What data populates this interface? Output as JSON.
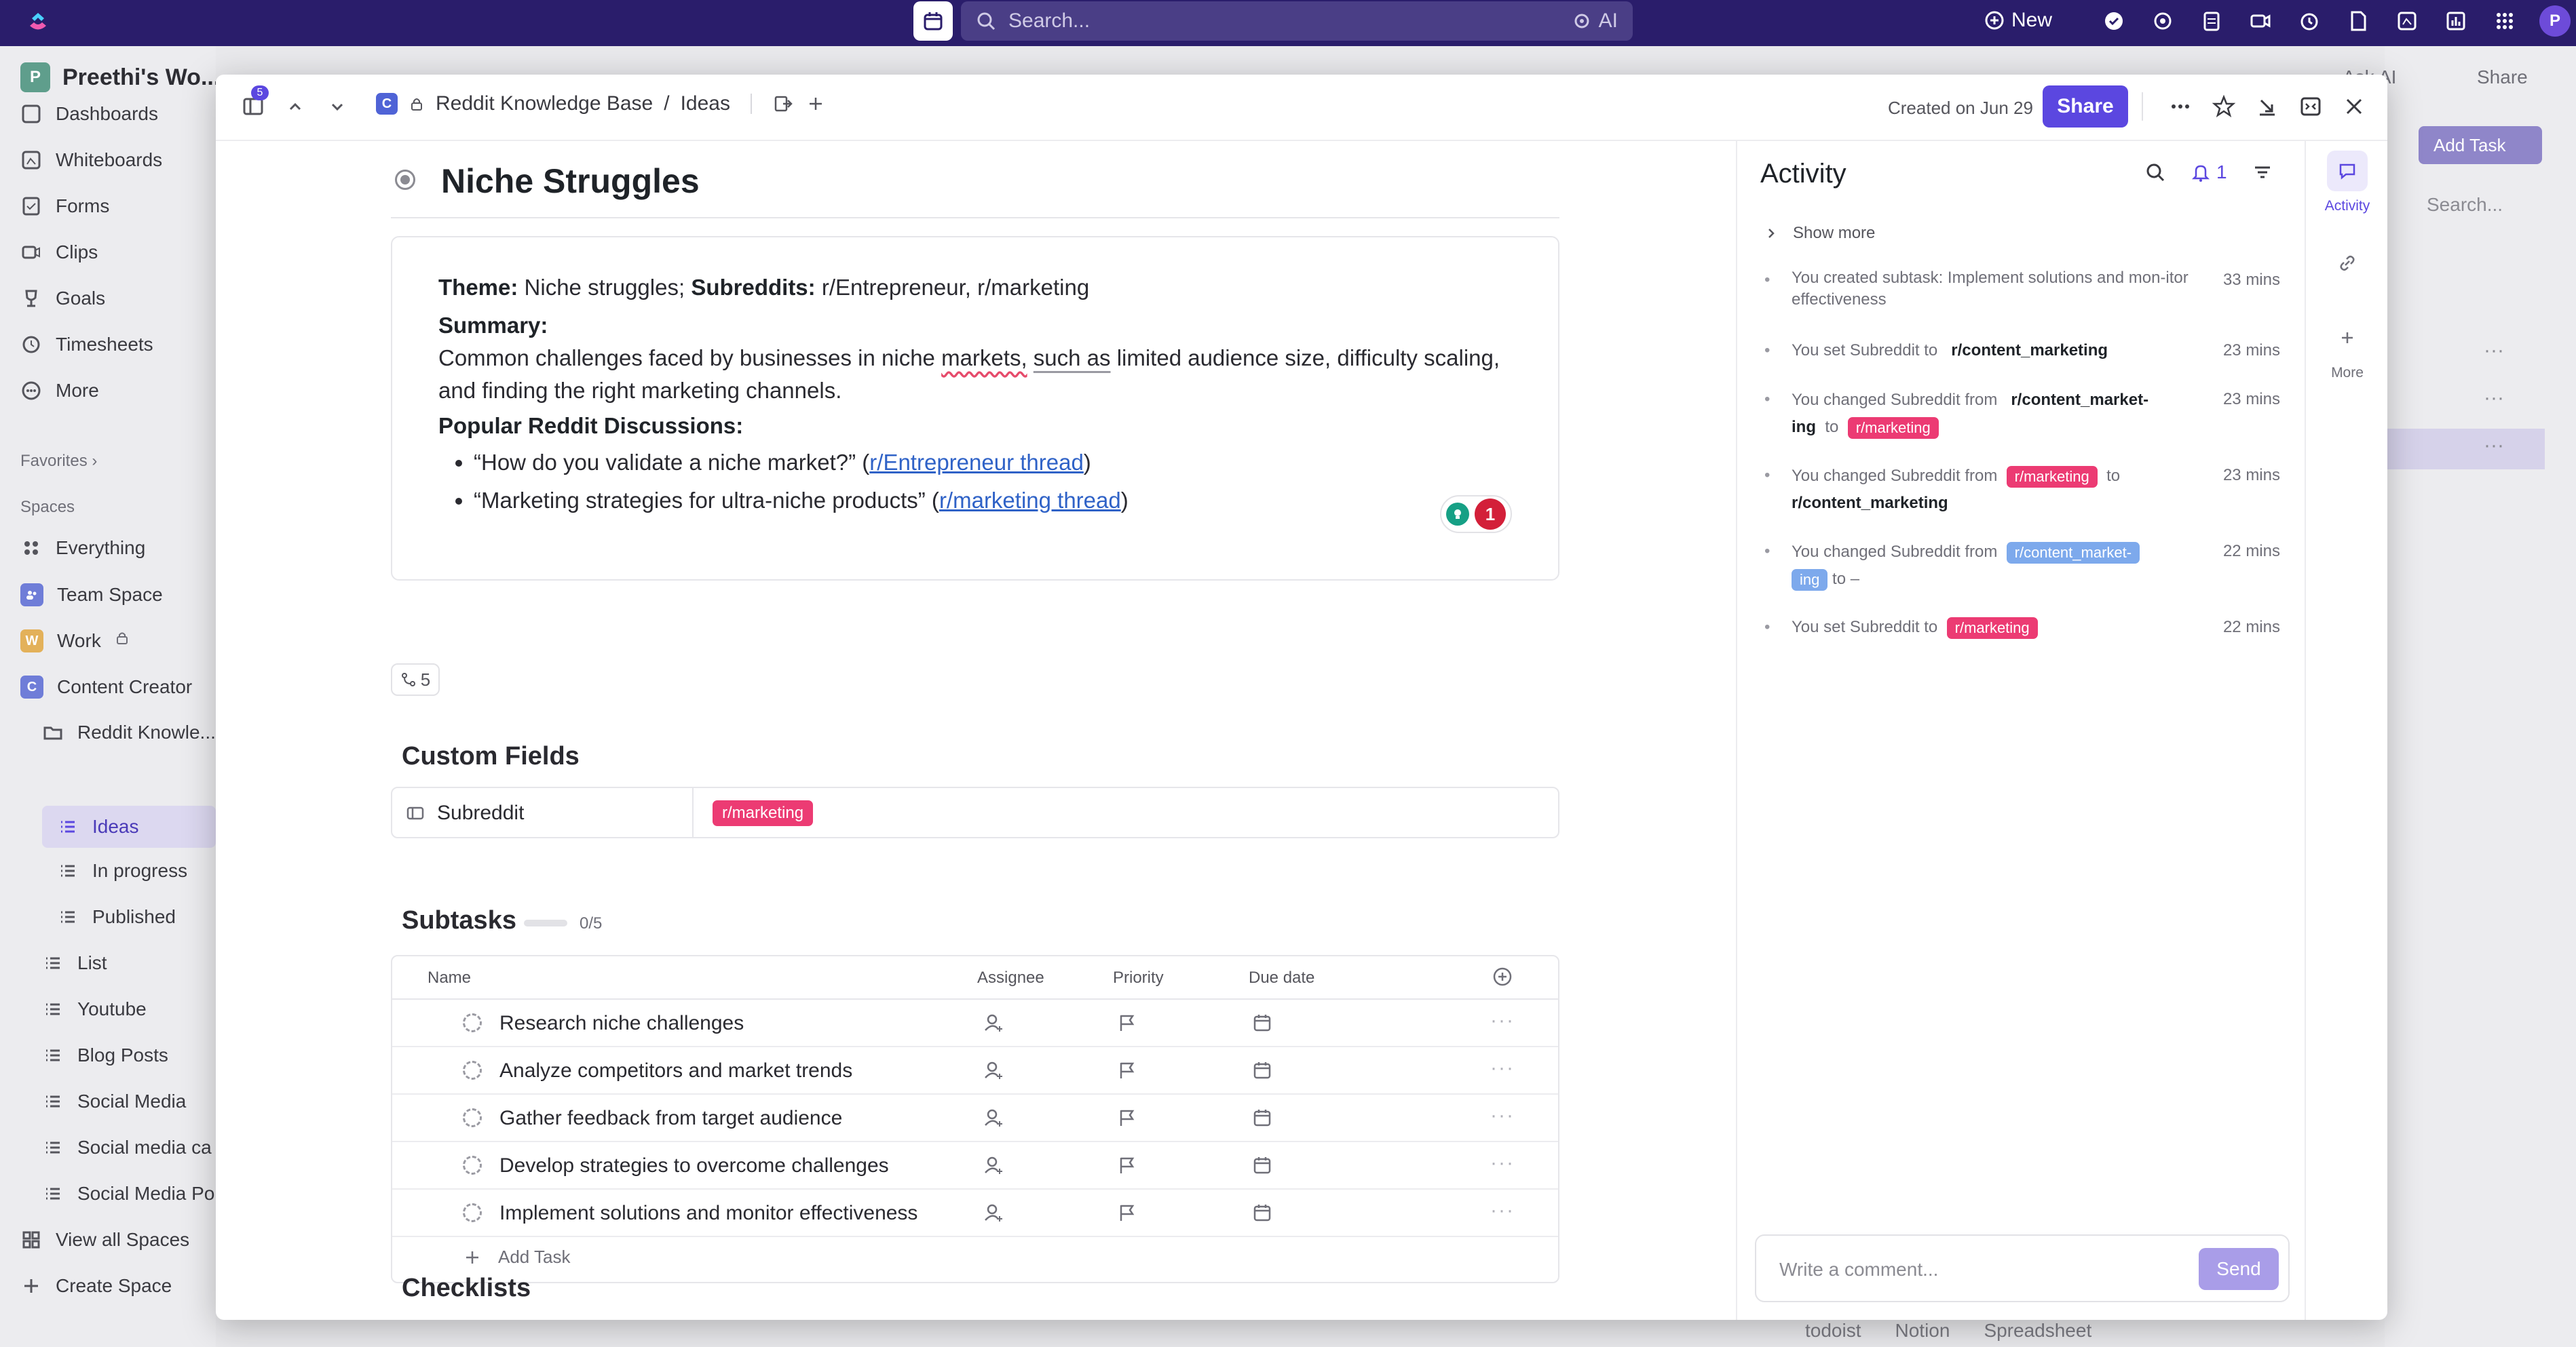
{
  "topbar": {
    "search_placeholder": "Search...",
    "ai_label": "AI",
    "new_label": "New",
    "avatar_initial": "P",
    "icons": [
      "check-circle-icon",
      "gear-icon",
      "clipboard-icon",
      "video-icon",
      "alarm-clock-icon",
      "document-icon",
      "whiteboard-icon",
      "dashboard-icon",
      "apps-grid-icon"
    ]
  },
  "sidebar": {
    "workspace_initial": "P",
    "workspace_name": "Preethi's Wo...",
    "items": [
      {
        "label": "Dashboards",
        "icon": "dashboard-icon"
      },
      {
        "label": "Whiteboards",
        "icon": "whiteboard-icon"
      },
      {
        "label": "Forms",
        "icon": "forms-icon"
      },
      {
        "label": "Clips",
        "icon": "clips-icon"
      },
      {
        "label": "Goals",
        "icon": "trophy-icon"
      },
      {
        "label": "Timesheets",
        "icon": "timesheet-icon"
      },
      {
        "label": "More",
        "icon": "more-icon"
      }
    ],
    "favorites_label": "Favorites",
    "spaces_label": "Spaces",
    "spaces": [
      {
        "label": "Everything"
      },
      {
        "label": "Team Space"
      },
      {
        "label": "Work",
        "initial": "W"
      },
      {
        "label": "Content Creator",
        "initial": "C"
      }
    ],
    "folder_label": "Reddit Knowle...",
    "lists": [
      {
        "label": "Ideas"
      },
      {
        "label": "In progress"
      },
      {
        "label": "Published"
      }
    ],
    "other_lists": [
      {
        "label": "List"
      },
      {
        "label": "Youtube"
      },
      {
        "label": "Blog Posts"
      },
      {
        "label": "Social Media"
      },
      {
        "label": "Social media ca"
      },
      {
        "label": "Social Media Po"
      }
    ],
    "view_all_spaces": "View all Spaces",
    "create_space": "Create Space"
  },
  "background": {
    "ask_ai": "Ask AI",
    "share": "Share",
    "add_task": "Add Task",
    "search": "Search..."
  },
  "modal": {
    "sidebar_badge": "5",
    "breadcrumb": {
      "space_initial": "C",
      "folder": "Reddit Knowledge Base",
      "separator": "/",
      "list": "Ideas"
    },
    "created": "Created on Jun 29",
    "share_label": "Share",
    "title": "Niche Struggles",
    "description": {
      "theme_label": "Theme:",
      "theme_value": "Niche struggles;",
      "subreddits_label": "Subreddits:",
      "subreddits_value": "r/Entrepreneur, r/marketing",
      "summary_label": "Summary:",
      "summary_pre": "Common challenges faced by businesses in niche ",
      "summary_u1": "markets,",
      "summary_u2": "such as",
      "summary_post": " limited audience size, difficulty scaling, and finding the right marketing channels.",
      "discussions_label": "Popular Reddit Discussions:",
      "discussions": [
        {
          "quote": "“How do you validate a niche market?” (",
          "link": "r/Entrepreneur thread",
          "close": ")"
        },
        {
          "quote": "“Marketing strategies for ultra-niche products” (",
          "link": "r/marketing thread",
          "close": ")"
        }
      ]
    },
    "reaction_count": "1",
    "relationships_count": "5",
    "custom_fields_title": "Custom Fields",
    "custom_field": {
      "name": "Subreddit",
      "value": "r/marketing"
    },
    "subtasks_title": "Subtasks",
    "subtasks_progress": "0/5",
    "subtasks_progress_fraction": 0,
    "subtask_columns": {
      "name": "Name",
      "assignee": "Assignee",
      "priority": "Priority",
      "due": "Due date"
    },
    "subtasks": [
      {
        "name": "Research niche challenges"
      },
      {
        "name": "Analyze competitors and market trends"
      },
      {
        "name": "Gather feedback from target audience"
      },
      {
        "name": "Develop strategies to overcome challenges"
      },
      {
        "name": "Implement solutions and monitor effectiveness"
      }
    ],
    "add_task_label": "Add Task",
    "checklists_title": "Checklists"
  },
  "activity": {
    "title": "Activity",
    "notification_count": "1",
    "show_more": "Show more",
    "items": [
      {
        "text": "You created subtask: Implement solutions and mon-itor effectiveness",
        "time": "33 mins"
      },
      {
        "pre": "You set Subreddit to",
        "to_value": "r/content_marketing",
        "time": "23 mins"
      },
      {
        "pre": "You changed Subreddit from",
        "from_value": "r/content_market-ing",
        "mid": "to",
        "to_value": "r/marketing",
        "time": "23 mins"
      },
      {
        "pre": "You changed Subreddit from",
        "from_value": "r/marketing",
        "mid": "to",
        "to_value": "r/content_marketing",
        "time": "23 mins"
      },
      {
        "pre": "You changed Subreddit from",
        "from_value_a": "r/content_market-",
        "from_value_b": "ing",
        "mid": "to –",
        "time": "22 mins"
      },
      {
        "pre": "You set Subreddit to",
        "to_value": "r/marketing",
        "time": "22 mins"
      }
    ],
    "comment_placeholder": "Write a comment...",
    "send_label": "Send"
  },
  "rail": {
    "activity_label": "Activity",
    "more_label": "More"
  },
  "bottom_bar": [
    "todoist",
    "Notion",
    "Spreadsheet"
  ],
  "colors": {
    "topbar": "#2a1d6b",
    "accent": "#5b47e0",
    "tag_pink": "#ec3b73",
    "tag_blue": "#7da9ec",
    "link": "#2f62c7"
  }
}
